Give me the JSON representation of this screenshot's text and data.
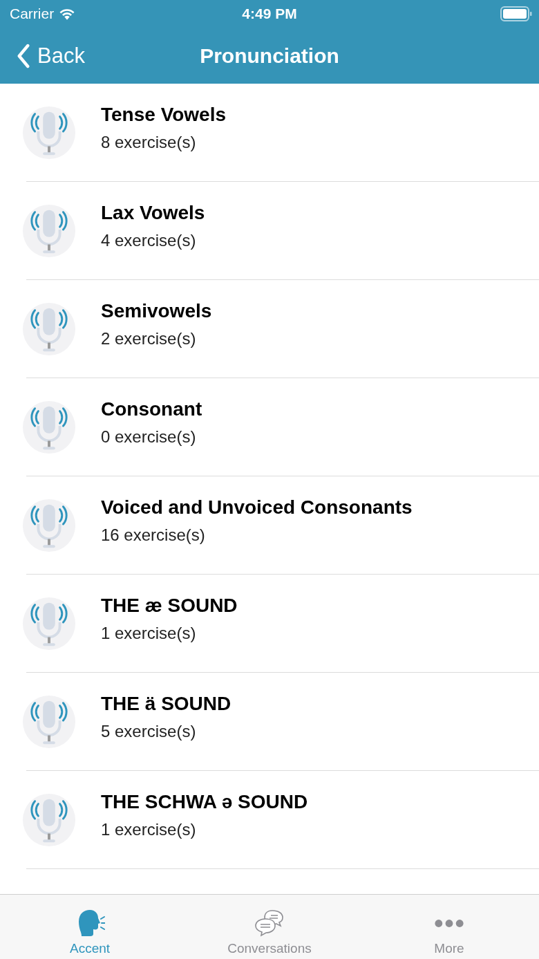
{
  "status_bar": {
    "carrier": "Carrier",
    "time": "4:49 PM"
  },
  "nav": {
    "back": "Back",
    "title": "Pronunciation"
  },
  "items": [
    {
      "title": "Tense Vowels",
      "subtitle": "8 exercise(s)"
    },
    {
      "title": "Lax Vowels",
      "subtitle": "4 exercise(s)"
    },
    {
      "title": "Semivowels",
      "subtitle": "2 exercise(s)"
    },
    {
      "title": "Consonant",
      "subtitle": "0 exercise(s)"
    },
    {
      "title": "Voiced and Unvoiced Consonants",
      "subtitle": "16 exercise(s)"
    },
    {
      "title": "THE æ SOUND",
      "subtitle": "1 exercise(s)"
    },
    {
      "title": "THE ä SOUND",
      "subtitle": "5 exercise(s)"
    },
    {
      "title": "THE SCHWA ə SOUND",
      "subtitle": "1 exercise(s)"
    }
  ],
  "tabs": [
    {
      "label": "Accent",
      "kind": "speaker",
      "selected": true
    },
    {
      "label": "Conversations",
      "kind": "chat",
      "selected": false
    },
    {
      "label": "More",
      "kind": "more",
      "selected": false
    }
  ]
}
